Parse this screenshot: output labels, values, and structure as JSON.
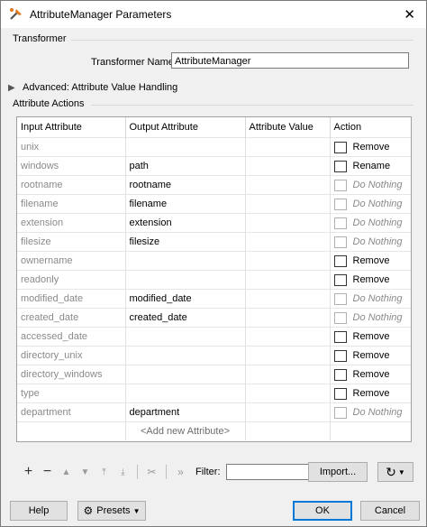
{
  "window": {
    "title": "AttributeManager Parameters",
    "close_symbol": "✕"
  },
  "transformer": {
    "group_label": "Transformer",
    "name_label": "Transformer Name:",
    "name_value": "AttributeManager"
  },
  "advanced": {
    "label": "Advanced: Attribute Value Handling"
  },
  "attribute_actions": {
    "group_label": "Attribute Actions",
    "columns": [
      "Input Attribute",
      "Output Attribute",
      "Attribute Value",
      "Action"
    ],
    "rows": [
      {
        "input": "unix",
        "output": "",
        "value": "",
        "action": "Remove",
        "active": true
      },
      {
        "input": "windows",
        "output": "path",
        "value": "",
        "action": "Rename",
        "active": true
      },
      {
        "input": "rootname",
        "output": "rootname",
        "value": "",
        "action": "Do Nothing",
        "active": false
      },
      {
        "input": "filename",
        "output": "filename",
        "value": "",
        "action": "Do Nothing",
        "active": false
      },
      {
        "input": "extension",
        "output": "extension",
        "value": "",
        "action": "Do Nothing",
        "active": false
      },
      {
        "input": "filesize",
        "output": "filesize",
        "value": "",
        "action": "Do Nothing",
        "active": false
      },
      {
        "input": "ownername",
        "output": "",
        "value": "",
        "action": "Remove",
        "active": true
      },
      {
        "input": "readonly",
        "output": "",
        "value": "",
        "action": "Remove",
        "active": true
      },
      {
        "input": "modified_date",
        "output": "modified_date",
        "value": "",
        "action": "Do Nothing",
        "active": false
      },
      {
        "input": "created_date",
        "output": "created_date",
        "value": "",
        "action": "Do Nothing",
        "active": false
      },
      {
        "input": "accessed_date",
        "output": "",
        "value": "",
        "action": "Remove",
        "active": true
      },
      {
        "input": "directory_unix",
        "output": "",
        "value": "",
        "action": "Remove",
        "active": true
      },
      {
        "input": "directory_windows",
        "output": "",
        "value": "",
        "action": "Remove",
        "active": true
      },
      {
        "input": "type",
        "output": "",
        "value": "",
        "action": "Remove",
        "active": true
      },
      {
        "input": "department",
        "output": "department",
        "value": "",
        "action": "Do Nothing",
        "active": false
      }
    ],
    "add_row_label": "<Add new Attribute>"
  },
  "toolbar": {
    "add_icon": "+",
    "remove_icon": "−",
    "move_up_icon": "▲",
    "move_down_icon": "▼",
    "move_top_icon": "⤒",
    "move_bottom_icon": "⤓",
    "cut_icon": "✂",
    "expand_icon": "»",
    "filter_label": "Filter:",
    "filter_value": "",
    "import_label": "Import...",
    "refresh_icon": "↻"
  },
  "footer": {
    "help_label": "Help",
    "presets_label": "Presets",
    "ok_label": "OK",
    "cancel_label": "Cancel"
  },
  "colors": {
    "accent": "#0078d7",
    "dim_text": "#8a8a8a"
  }
}
